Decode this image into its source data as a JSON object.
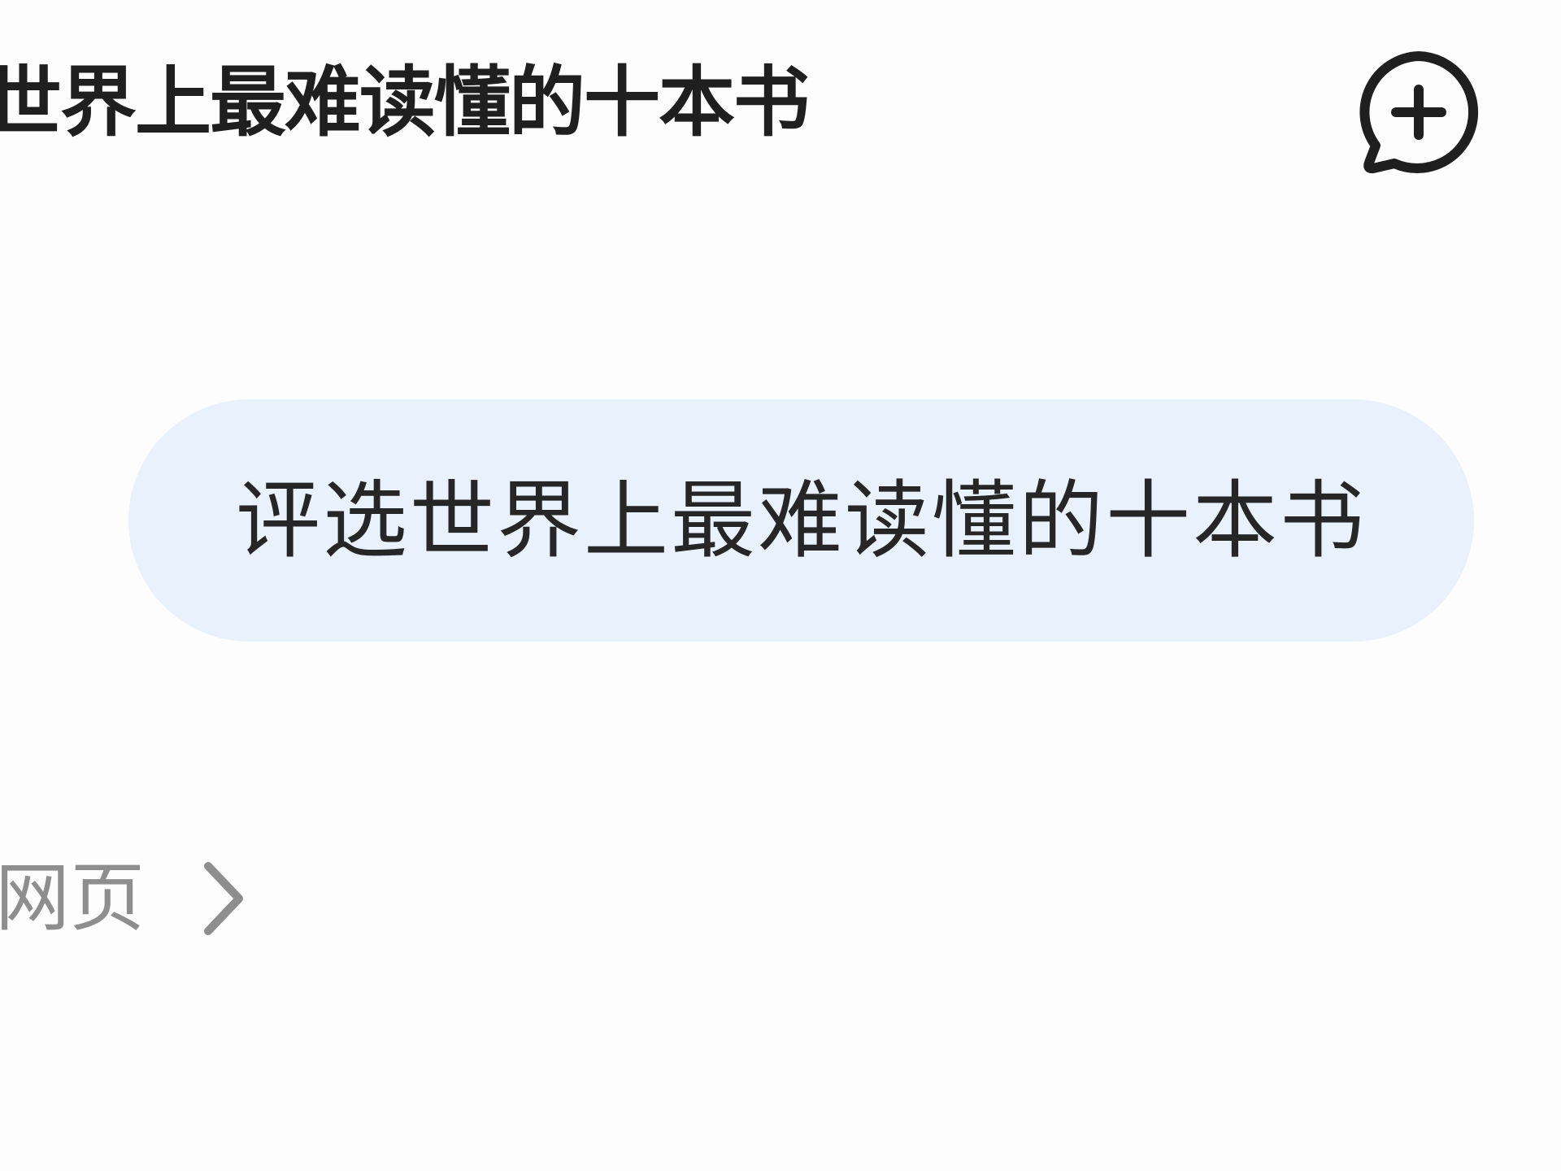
{
  "header": {
    "title": "世界上最难读懂的十本书",
    "new_chat_icon": "chat-bubble-plus-icon"
  },
  "conversation": {
    "user_message": "评选世界上最难读懂的十本书"
  },
  "sources": {
    "link_label": "网页",
    "link_icon": "chevron-right-icon"
  },
  "colors": {
    "bubble_background": "#e9f1fd",
    "primary_text": "#1f1f1f",
    "secondary_text": "#8e8e8e"
  }
}
